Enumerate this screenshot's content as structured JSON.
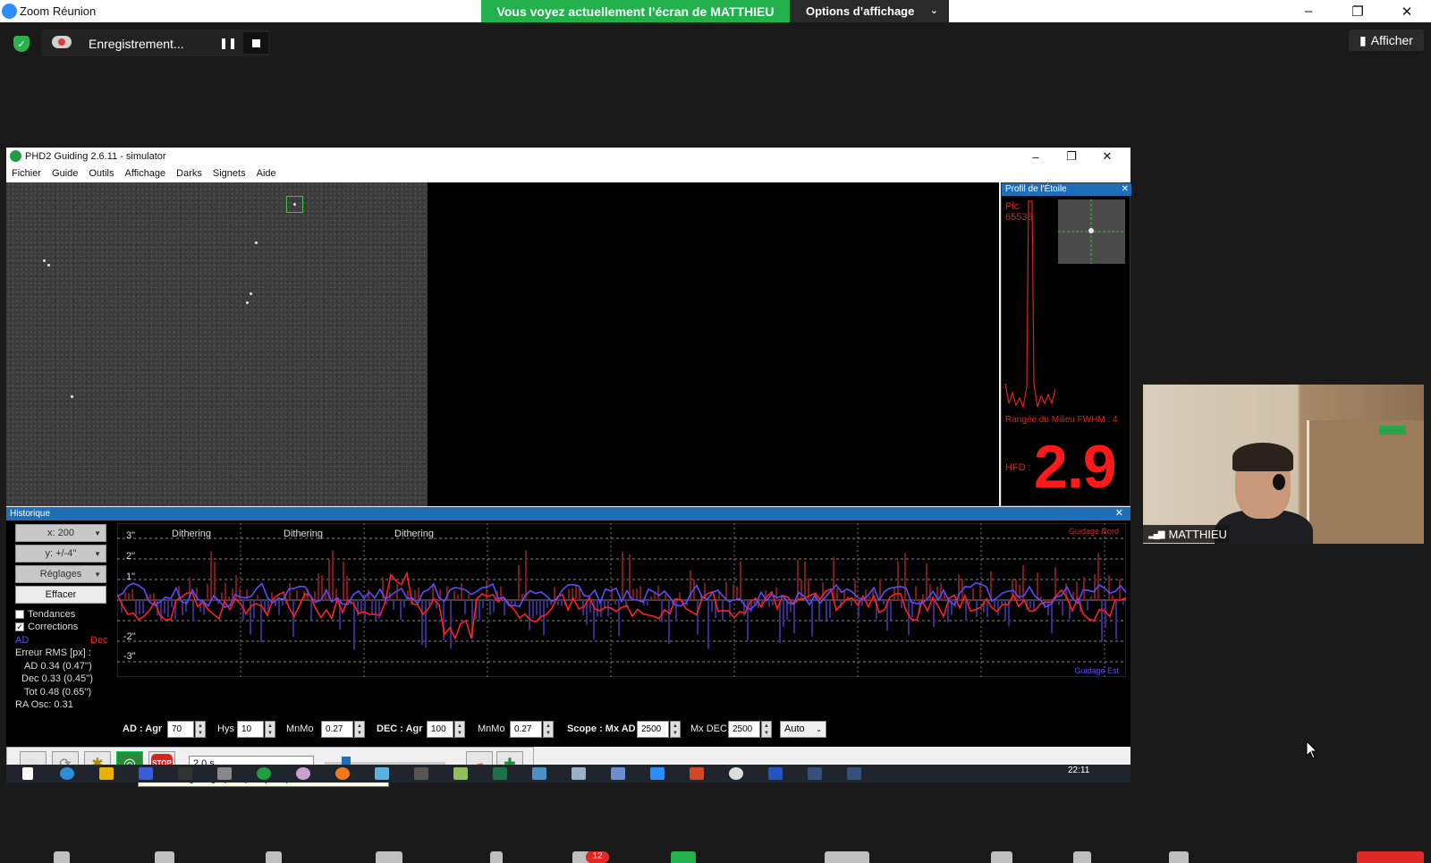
{
  "zoom": {
    "window_title": "Zoom Réunion",
    "share_banner": "Vous voyez actuellement l’écran de MATTHIEU",
    "display_options": "Options d’affichage",
    "recording_label": "Enregistrement...",
    "show_button": "Afficher",
    "participant_name": "MATTHIEU",
    "participants_badge": "12"
  },
  "phd": {
    "window_title": "PHD2 Guiding 2.6.11 - simulator",
    "menu": [
      "Fichier",
      "Guide",
      "Outils",
      "Affichage",
      "Darks",
      "Signets",
      "Aide"
    ],
    "profile": {
      "title": "Profil de l'Étoile",
      "peak_label": "Pic",
      "peak_value": "65535",
      "fwhm_label": "Rangée du Milieu FWHM : 4",
      "hfd_label": "HFD :",
      "hfd_value": "2.9"
    },
    "history": {
      "title": "Historique",
      "x_scale": "x: 200",
      "y_scale": "y: +/-4''",
      "settings": "Réglages",
      "clear": "Effacer",
      "trends": "Tendances",
      "corrections": "Corrections",
      "legend_ra": "AD",
      "legend_dec": "Dec",
      "rms_title": "Erreur RMS [px] :",
      "rms_ra": "AD 0.34 (0.47'')",
      "rms_dec": "Dec 0.33 (0.45'')",
      "rms_tot": "Tot 0.48 (0.65'')",
      "ra_osc": "RA Osc: 0.31",
      "guide_north": "Guidage Nord",
      "guide_east": "Guidage Est",
      "dither_labels": [
        "Dithering",
        "Dithering",
        "Dithering"
      ],
      "y_ticks": [
        "3\"",
        "2\"",
        "1\"",
        "-2\"",
        "-3\""
      ]
    },
    "params": {
      "ra_label": "AD : Agr",
      "ra_agr": "70",
      "hys_label": "Hys",
      "hys": "10",
      "mnmo_label": "MnMo",
      "ra_mnmo": "0.27",
      "dec_label": "DEC : Agr",
      "dec_agr": "100",
      "dec_mnmo_label": "MnMo",
      "dec_mnmo": "0.27",
      "scope_label": "Scope : Mx AD",
      "mx_ra": "2500",
      "mx_dec_label": "Mx DEC",
      "mx_dec": "2500",
      "dec_mode": "Auto"
    },
    "toolbar": {
      "exposure": "2.0 s",
      "stop": "STOP",
      "tooltip": "Démarre le guidage (PHD). Maj-clic pour forcer la calibration."
    }
  },
  "taskbar": {
    "clock": "22:11"
  },
  "colors": {
    "ra": "#5a4cff",
    "dec": "#ff2020",
    "share_green": "#22b14c",
    "panel_blue": "#1e6fb8"
  }
}
